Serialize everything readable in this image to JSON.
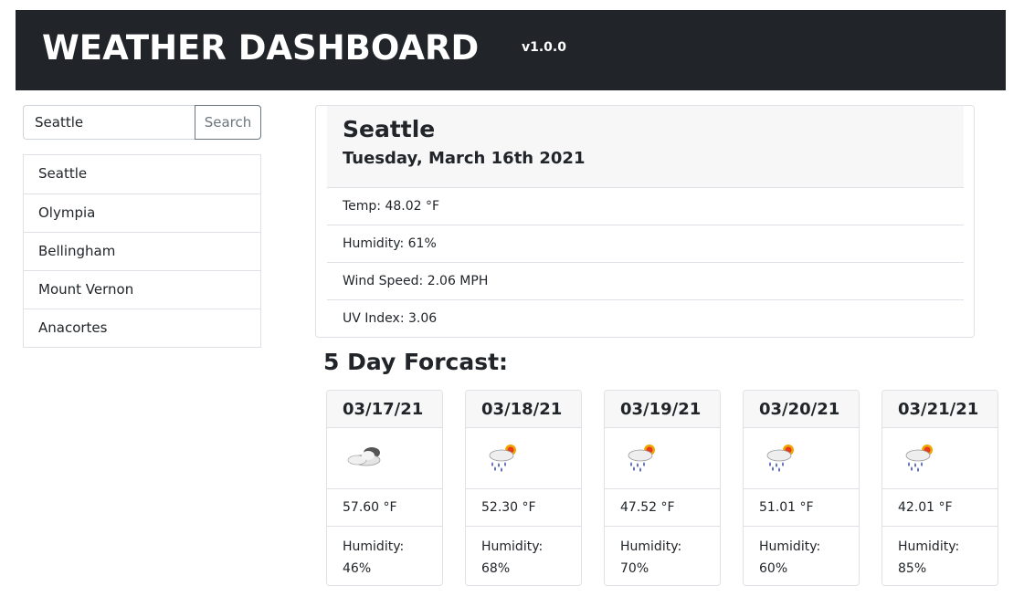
{
  "header": {
    "title": "WEATHER DASHBOARD",
    "version": "v1.0.0"
  },
  "search": {
    "value": "Seattle",
    "button_label": "Search"
  },
  "history": [
    "Seattle",
    "Olympia",
    "Bellingham",
    "Mount Vernon",
    "Anacortes"
  ],
  "current": {
    "city": "Seattle",
    "date": "Tuesday, March 16th 2021",
    "temp": "Temp: 48.02 °F",
    "humidity": "Humidity: 61%",
    "wind": "Wind Speed: 2.06 MPH",
    "uv": "UV Index: 3.06"
  },
  "forecast_title": "5 Day Forcast:",
  "forecast": [
    {
      "date": "03/17/21",
      "icon": "cloudy-icon",
      "temp": "57.60 °F",
      "humidity_label": "Humidity:",
      "humidity": "46%"
    },
    {
      "date": "03/18/21",
      "icon": "rain-sun-icon",
      "temp": "52.30 °F",
      "humidity_label": "Humidity:",
      "humidity": "68%"
    },
    {
      "date": "03/19/21",
      "icon": "rain-sun-icon",
      "temp": "47.52 °F",
      "humidity_label": "Humidity:",
      "humidity": "70%"
    },
    {
      "date": "03/20/21",
      "icon": "rain-sun-icon",
      "temp": "51.01 °F",
      "humidity_label": "Humidity:",
      "humidity": "60%"
    },
    {
      "date": "03/21/21",
      "icon": "rain-sun-icon",
      "temp": "42.01 °F",
      "humidity_label": "Humidity:",
      "humidity": "85%"
    }
  ]
}
